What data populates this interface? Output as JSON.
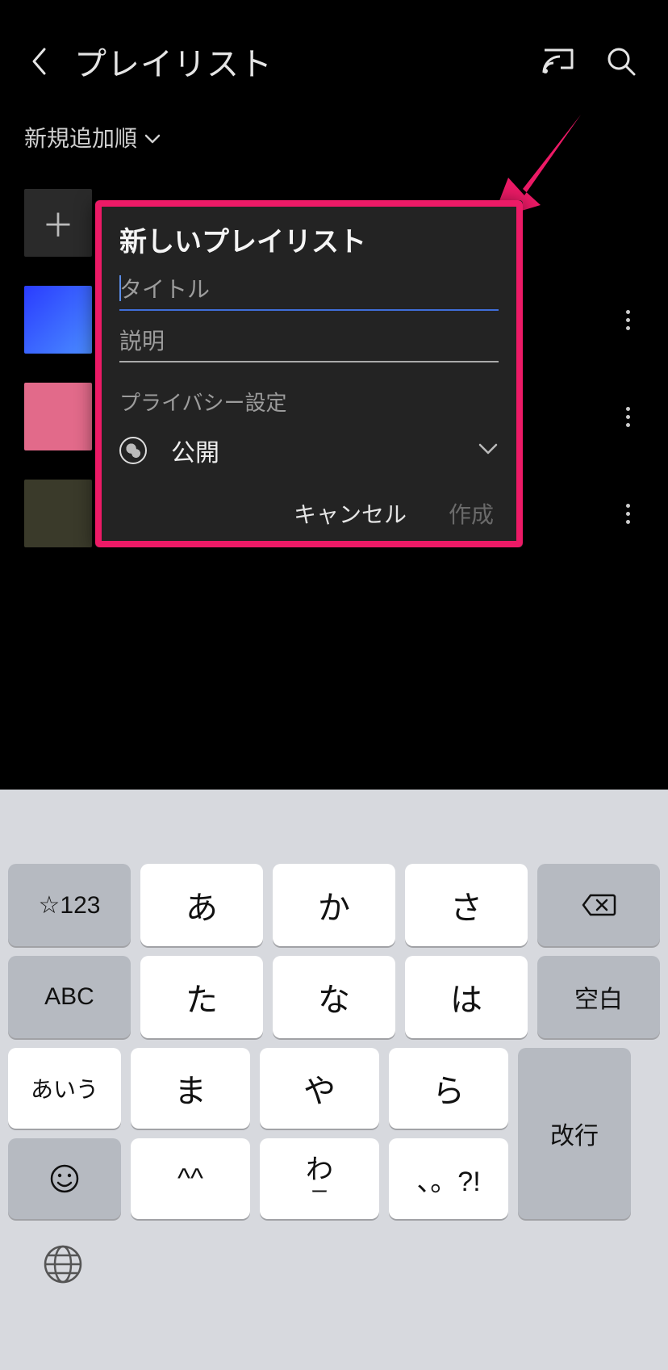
{
  "header": {
    "title": "プレイリスト"
  },
  "sort": {
    "label": "新規追加順"
  },
  "dialog": {
    "title": "新しいプレイリスト",
    "title_placeholder": "タイトル",
    "desc_placeholder": "説明",
    "privacy_section": "プライバシー設定",
    "privacy_value": "公開",
    "cancel": "キャンセル",
    "create": "作成"
  },
  "keyboard": {
    "r1": {
      "k0": "☆123",
      "k1": "あ",
      "k2": "か",
      "k3": "さ"
    },
    "r2": {
      "k0": "ABC",
      "k1": "た",
      "k2": "な",
      "k3": "は",
      "k4": "空白"
    },
    "r3": {
      "k0": "あいう",
      "k1": "ま",
      "k2": "や",
      "k3": "ら"
    },
    "r4": {
      "k1": "^^",
      "k2": "わ",
      "k2sub": "ー",
      "k3": "、。?!"
    },
    "return": "改行"
  }
}
